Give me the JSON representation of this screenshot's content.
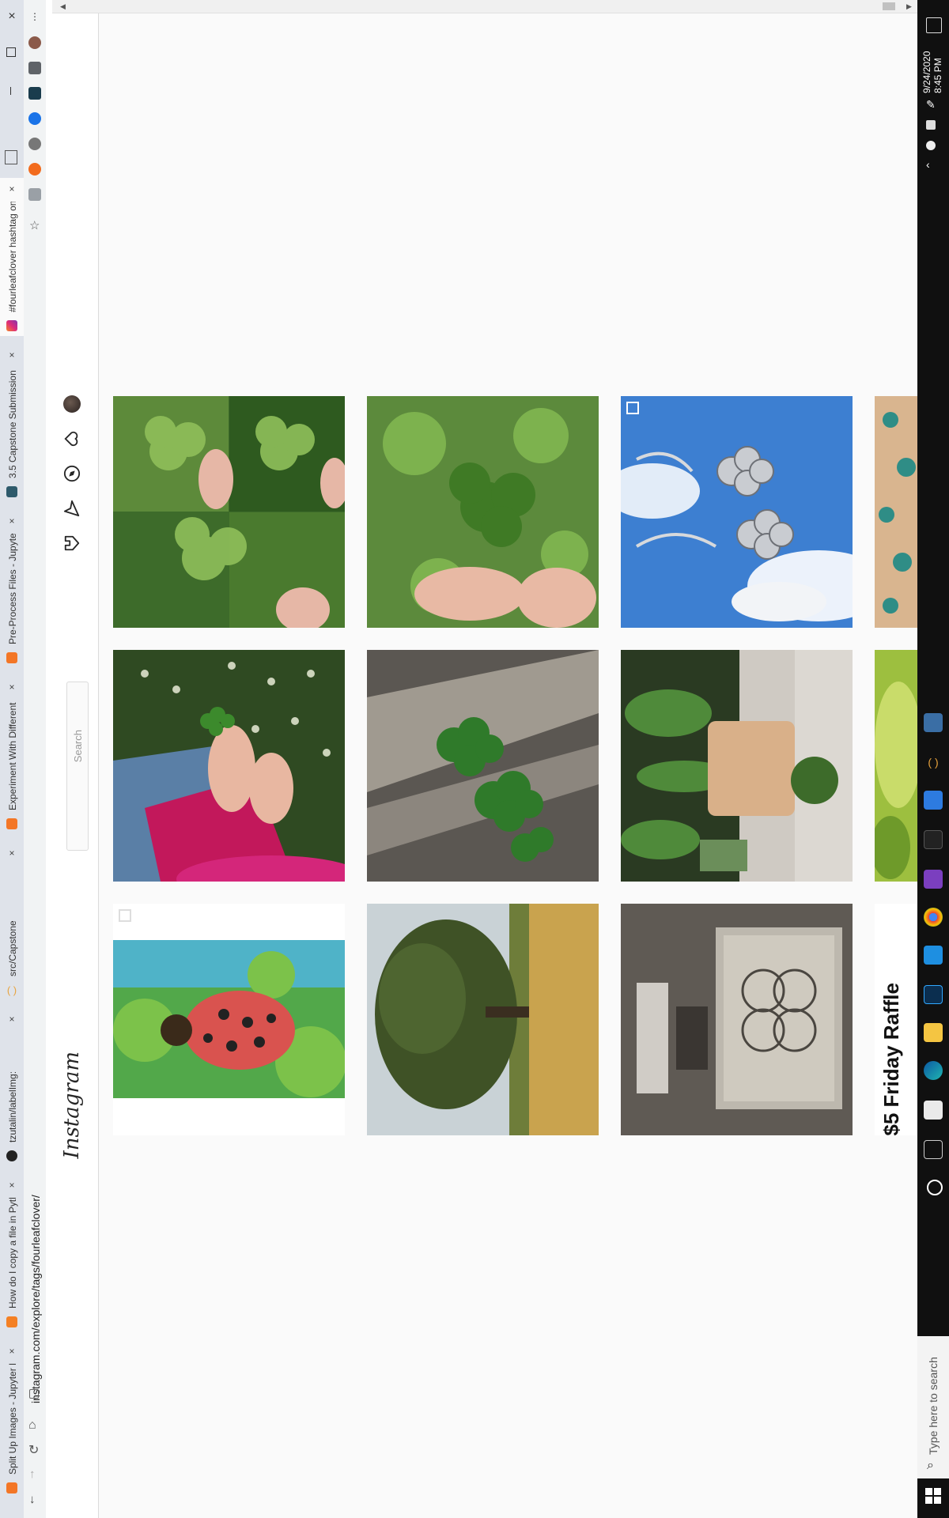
{
  "browser": {
    "tabs": [
      {
        "label": "#fourleafclover hashtag on",
        "active": true
      },
      {
        "label": "3.5 Capstone Submission -"
      },
      {
        "label": "Pre-Process Files - Jupyter"
      },
      {
        "label": "Experiment With Different"
      },
      {
        "label": "src/Capstone/"
      },
      {
        "label": "tzutalin/labelImg:"
      },
      {
        "label": "How do I copy a file in Pyth"
      },
      {
        "label": "Split Up Images - Jupyter N"
      }
    ],
    "address": "instagram.com/explore/tags/fourleafclover/",
    "window_controls": {
      "close": "×",
      "maximize": "□",
      "minimize": "—"
    }
  },
  "instagram": {
    "logo": "Instagram",
    "search_placeholder": "Search",
    "raffle_text": "$5 Friday Raffle"
  },
  "taskbar": {
    "time": "8:45 PM",
    "date": "9/24/2020",
    "search_placeholder": "Type here to search"
  },
  "colors": {
    "taskbar": "#101010",
    "ig_background": "#fafafa",
    "tab_strip": "#dfe3ea"
  }
}
